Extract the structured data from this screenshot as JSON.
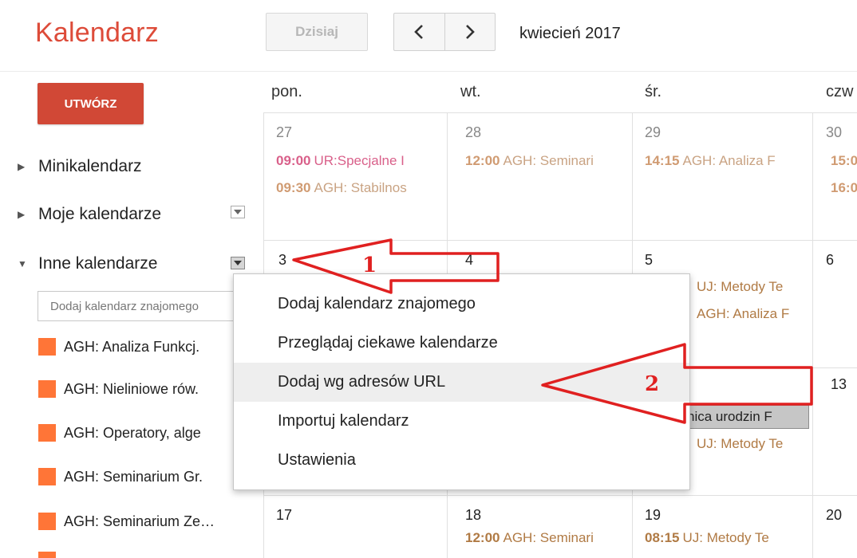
{
  "header": {
    "app_title": "Kalendarz",
    "today_label": "Dzisiaj",
    "prev_icon": "chevron-left-icon",
    "next_icon": "chevron-right-icon",
    "period": "kwiecień 2017"
  },
  "sidebar": {
    "create_label": "UTWÓRZ",
    "sections": [
      {
        "label": "Minikalendarz"
      },
      {
        "label": "Moje kalendarze"
      },
      {
        "label": "Inne kalendarze"
      }
    ],
    "add_friend_placeholder": "Dodaj kalendarz znajomego",
    "calendar_color": "#ff7537",
    "calendars": [
      {
        "label": "AGH: Analiza Funkcj."
      },
      {
        "label": "AGH: Nieliniowe rów."
      },
      {
        "label": "AGH: Operatory, alge"
      },
      {
        "label": "AGH: Seminarium Gr."
      },
      {
        "label": "AGH: Seminarium Ze…"
      }
    ]
  },
  "grid": {
    "days": [
      "pon.",
      "wt.",
      "śr.",
      "czw"
    ],
    "week1": {
      "d0": "27",
      "d1": "28",
      "d2": "29",
      "d3": "30",
      "e0a_time": "09:00",
      "e0a_title": "UR:Specjalne I",
      "e0b_time": "09:30",
      "e0b_title": "AGH: Stabilnos",
      "e1a_time": "12:00",
      "e1a_title": "AGH: Seminari",
      "e2a_time": "14:15",
      "e2a_title": "AGH: Analiza F",
      "e3a_time": "15:0",
      "e3b_time": "16:0"
    },
    "week2": {
      "d0": "3",
      "d1": "4",
      "d2": "5",
      "d3": "6",
      "e2a_title": "UJ: Metody Te",
      "e2b_title": "AGH: Analiza F"
    },
    "week3": {
      "d3": "13",
      "box_title": "nica urodzin F",
      "e2a_title": "UJ: Metody Te"
    },
    "week4": {
      "d0": "17",
      "d1": "18",
      "d2": "19",
      "d3": "20",
      "e1a_time": "12:00",
      "e1a_title": "AGH: Seminari",
      "e2a_time": "08:15",
      "e2a_title": "UJ: Metody Te"
    }
  },
  "menu": {
    "items": [
      {
        "label": "Dodaj kalendarz znajomego"
      },
      {
        "label": "Przeglądaj ciekawe kalendarze"
      },
      {
        "label": "Dodaj wg adresów URL"
      },
      {
        "label": "Importuj kalendarz"
      },
      {
        "label": "Ustawienia"
      }
    ]
  },
  "annotations": {
    "color": "#e02020",
    "step1": "1",
    "step2": "2"
  }
}
